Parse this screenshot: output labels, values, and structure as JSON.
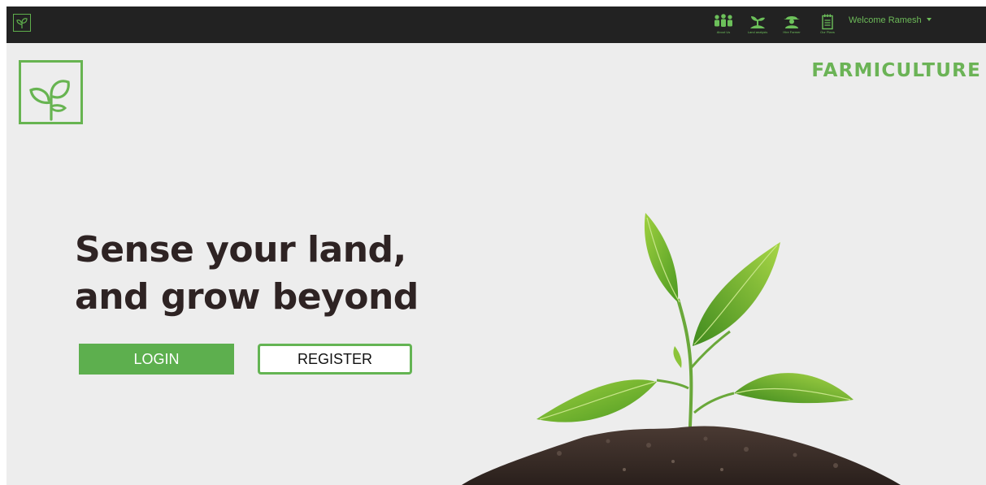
{
  "navbar": {
    "items": [
      {
        "label": "About Us",
        "icon": "team-icon"
      },
      {
        "label": "Land analysis",
        "icon": "sprout-icon"
      },
      {
        "label": "Hire Farmer",
        "icon": "farmer-icon"
      },
      {
        "label": "Our Plans",
        "icon": "notepad-icon"
      }
    ],
    "user_menu": "Welcome Ramesh"
  },
  "brand": {
    "name": "FARMICULTURE",
    "logo_icon": "sprout-logo-icon"
  },
  "hero": {
    "headline_line1": "Sense your land,",
    "headline_line2": "and grow beyond",
    "login_label": "LOGIN",
    "register_label": "REGISTER",
    "image": "plant-in-soil"
  },
  "colors": {
    "accent": "#5daf4e",
    "navbar_bg": "#222222",
    "page_bg": "#ededed",
    "headline": "#2e2323"
  }
}
